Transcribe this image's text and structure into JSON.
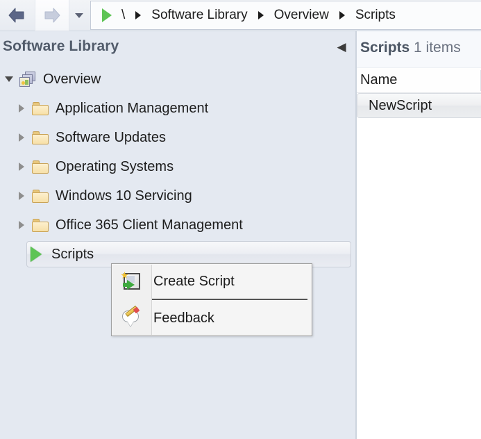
{
  "toolbar": {
    "back_label": "Back",
    "forward_label": "Forward",
    "dropdown_label": "Recent locations",
    "breadcrumb": {
      "root": "\\",
      "icon": "green-play-icon",
      "items": [
        {
          "label": "Software Library"
        },
        {
          "label": "Overview"
        },
        {
          "label": "Scripts"
        }
      ]
    }
  },
  "sidebar": {
    "title": "Software Library",
    "collapse_icon": "chevron-left-icon",
    "collapse_glyph": "◀",
    "tree": [
      {
        "label": "Overview",
        "icon": "stacked-windows-icon",
        "expanded": true,
        "level": 0
      },
      {
        "label": "Application Management",
        "icon": "folder-icon",
        "expanded": false,
        "level": 1
      },
      {
        "label": "Software Updates",
        "icon": "folder-icon",
        "expanded": false,
        "level": 1
      },
      {
        "label": "Operating Systems",
        "icon": "folder-icon",
        "expanded": false,
        "level": 1
      },
      {
        "label": "Windows 10 Servicing",
        "icon": "folder-icon",
        "expanded": false,
        "level": 1
      },
      {
        "label": "Office 365 Client Management",
        "icon": "folder-icon",
        "expanded": false,
        "level": 1
      },
      {
        "label": "Scripts",
        "icon": "green-play-icon",
        "expanded": false,
        "level": 1,
        "selected": true
      }
    ]
  },
  "right_panel": {
    "title": "Scripts",
    "count_text": "1 items",
    "columns": [
      "Name"
    ],
    "rows": [
      {
        "name": "NewScript",
        "highlighted": true
      }
    ]
  },
  "context_menu": {
    "items": [
      {
        "label": "Create Script",
        "icon": "create-script-icon"
      },
      {
        "label": "Feedback",
        "icon": "feedback-pencil-icon"
      }
    ]
  },
  "colors": {
    "sidebar_bg": "#e4e9f1",
    "panel_bg": "#ffffff",
    "accent_green": "#5ec455",
    "folder_yellow": "#f7e0a7",
    "title_gray": "#525c6b",
    "text": "#1d1d1d",
    "menu_bg": "#f5f5f5"
  }
}
